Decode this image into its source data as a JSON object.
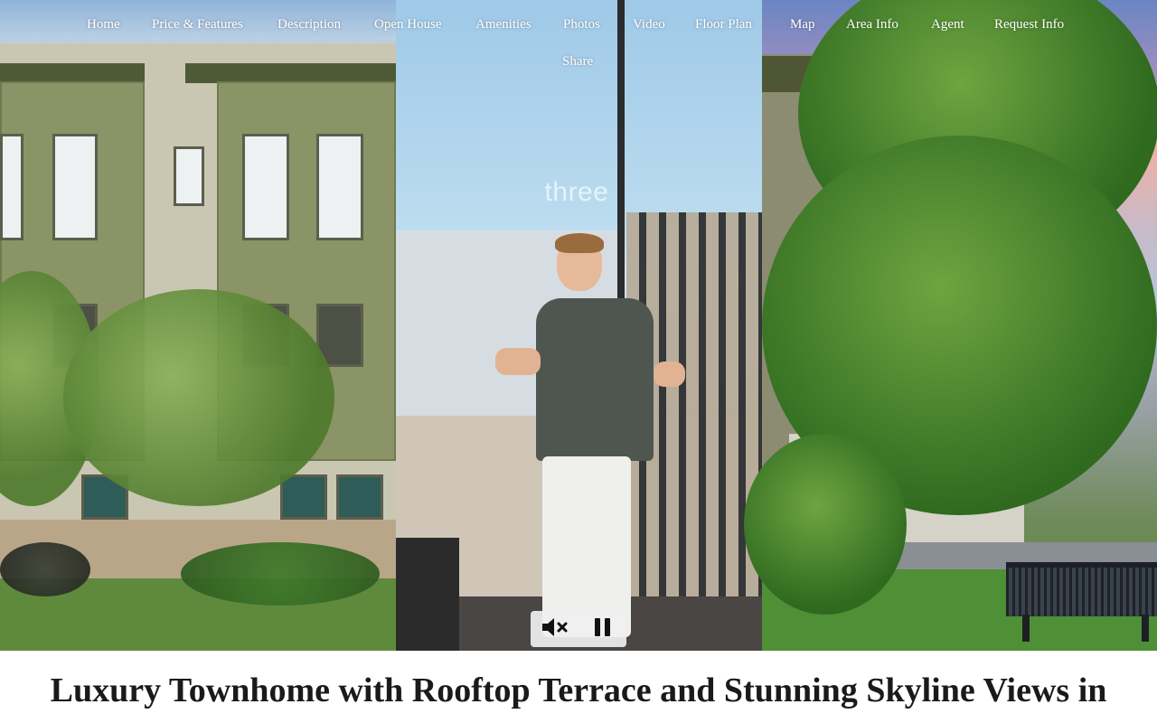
{
  "nav": {
    "items": [
      {
        "label": "Home"
      },
      {
        "label": "Price & Features"
      },
      {
        "label": "Description"
      },
      {
        "label": "Open House"
      },
      {
        "label": "Amenities"
      },
      {
        "label": "Photos"
      },
      {
        "label": "Video"
      },
      {
        "label": "Floor Plan"
      },
      {
        "label": "Map"
      },
      {
        "label": "Area Info"
      },
      {
        "label": "Agent"
      },
      {
        "label": "Request Info"
      }
    ],
    "share_label": "Share"
  },
  "video": {
    "watermark": "three",
    "controls": {
      "mute_icon": "speaker-muted-icon",
      "pause_icon": "pause-icon"
    }
  },
  "listing": {
    "title": "Luxury Townhome with Rooftop Terrace and Stunning Skyline Views in"
  }
}
